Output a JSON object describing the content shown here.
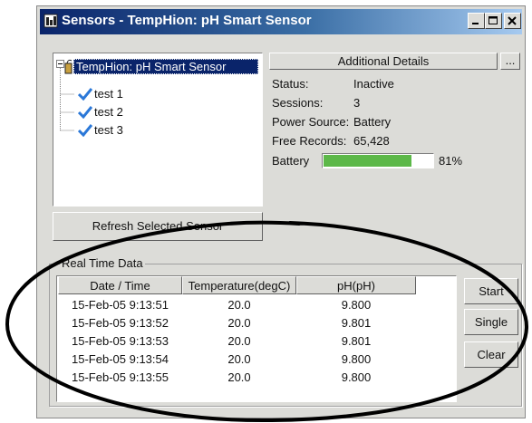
{
  "window": {
    "title": "Sensors - TempHion: pH Smart Sensor",
    "controls": [
      "minimize-icon",
      "maximize-icon",
      "close-icon"
    ]
  },
  "tree": {
    "root_label": "TempHion: pH Smart Sensor",
    "root_expand": "⊟",
    "items": [
      {
        "label": "test 1",
        "icon": "check-icon"
      },
      {
        "label": "test 2",
        "icon": "check-icon"
      },
      {
        "label": "test 3",
        "icon": "check-icon"
      }
    ]
  },
  "details": {
    "header_label": "Additional Details",
    "more_label": "...",
    "rows": [
      {
        "label": "Status:",
        "value": "Inactive"
      },
      {
        "label": "Sessions:",
        "value": "3"
      },
      {
        "label": "Power Source:",
        "value": "Battery"
      },
      {
        "label": "Free Records:",
        "value": "65,428"
      }
    ],
    "battery_label": "Battery",
    "battery_percent_text": "81%",
    "battery_level": 0.81,
    "battery_color": "#5cb848"
  },
  "refresh_button_label": "Refresh Selected Sensor",
  "realtime": {
    "group_label": "Real Time Data",
    "columns": [
      "Date / Time",
      "Temperature(degC)",
      "pH(pH)"
    ],
    "rows": [
      [
        "15-Feb-05  9:13:51",
        "20.0",
        "9.800"
      ],
      [
        "15-Feb-05  9:13:52",
        "20.0",
        "9.801"
      ],
      [
        "15-Feb-05  9:13:53",
        "20.0",
        "9.801"
      ],
      [
        "15-Feb-05  9:13:54",
        "20.0",
        "9.800"
      ],
      [
        "15-Feb-05  9:13:55",
        "20.0",
        "9.800"
      ]
    ],
    "buttons": {
      "start": "Start",
      "single": "Single",
      "clear": "Clear"
    }
  },
  "annotation_color": "#000000"
}
